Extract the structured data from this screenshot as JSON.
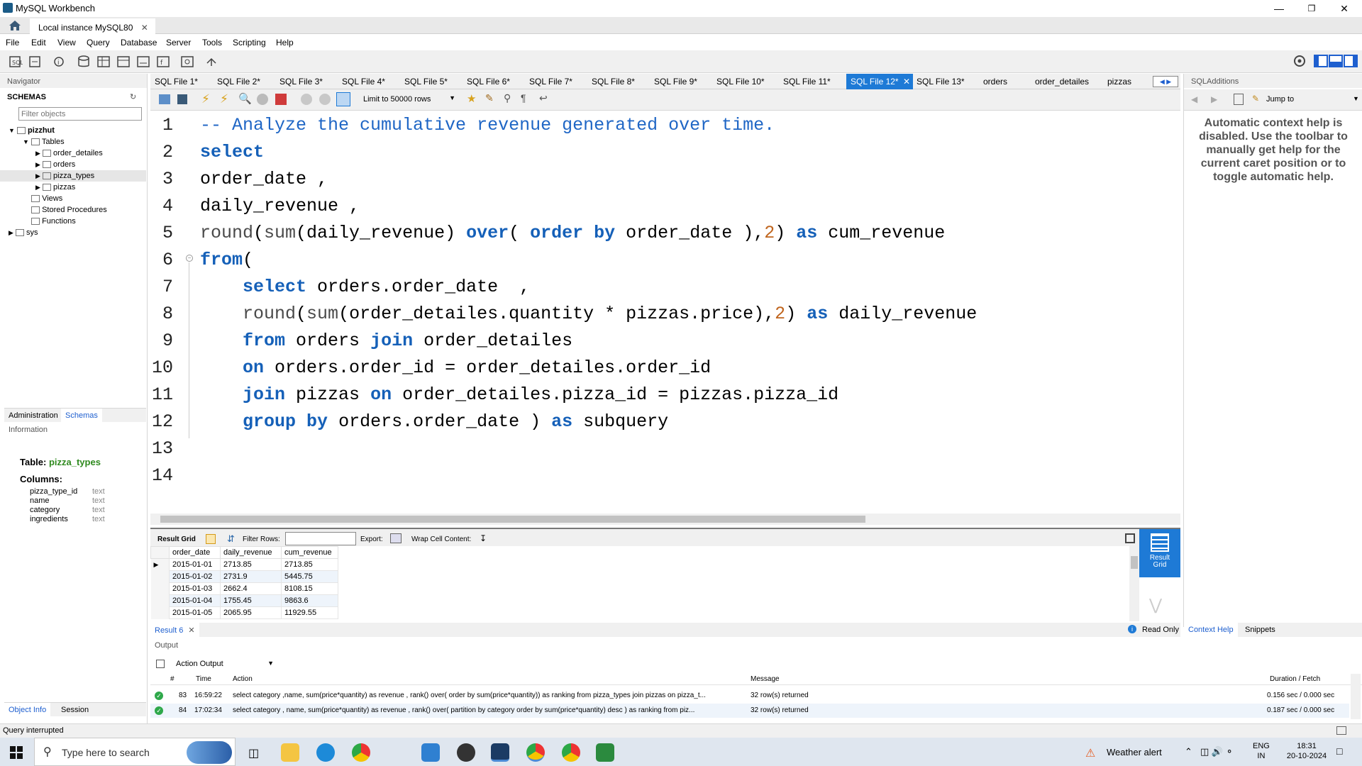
{
  "window": {
    "title": "MySQL Workbench",
    "connection_tab": "Local instance MySQL80"
  },
  "menu": [
    "File",
    "Edit",
    "View",
    "Query",
    "Database",
    "Server",
    "Tools",
    "Scripting",
    "Help"
  ],
  "navigator": {
    "header": "Navigator",
    "schemas_title": "SCHEMAS",
    "filter_placeholder": "Filter objects",
    "tree": {
      "db": "pizzhut",
      "tables_label": "Tables",
      "tables": [
        "order_detailes",
        "orders",
        "pizza_types",
        "pizzas"
      ],
      "views": "Views",
      "procs": "Stored Procedures",
      "funcs": "Functions",
      "sys": "sys"
    },
    "tabs": {
      "admin": "Administration",
      "schemas": "Schemas"
    },
    "info_header": "Information",
    "info": {
      "table_label": "Table:",
      "table_name": "pizza_types",
      "columns_label": "Columns:",
      "columns": [
        {
          "name": "pizza_type_id",
          "type": "text"
        },
        {
          "name": "name",
          "type": "text"
        },
        {
          "name": "category",
          "type": "text"
        },
        {
          "name": "ingredients",
          "type": "text"
        }
      ]
    },
    "bottom_tabs": {
      "object_info": "Object Info",
      "session": "Session"
    }
  },
  "editor_tabs": [
    "SQL File 1*",
    "SQL File 2*",
    "SQL File 3*",
    "SQL File 4*",
    "SQL File 5*",
    "SQL File 6*",
    "SQL File 7*",
    "SQL File 8*",
    "SQL File 9*",
    "SQL File 10*",
    "SQL File 11*",
    "SQL File 12*",
    "SQL File 13*",
    "orders",
    "order_detailes",
    "pizzas"
  ],
  "active_tab": "SQL File 12*",
  "editor_toolbar": {
    "limit": "Limit to 50000 rows"
  },
  "code": [
    "-- Analyze the cumulative revenue generated over time.",
    "select",
    "order_date ,",
    "daily_revenue ,",
    "round(sum(daily_revenue) over( order by order_date ),2) as cum_revenue",
    "from(",
    "    select orders.order_date  ,",
    "    round(sum(order_detailes.quantity * pizzas.price),2) as daily_revenue",
    "    from orders join order_detailes",
    "    on orders.order_id = order_detailes.order_id",
    "    join pizzas on order_detailes.pizza_id = pizzas.pizza_id",
    "    group by orders.order_date ) as subquery",
    "",
    ""
  ],
  "result_toolbar": {
    "result_grid": "Result Grid",
    "filter_rows": "Filter Rows:",
    "export": "Export:",
    "wrap": "Wrap Cell Content:"
  },
  "result": {
    "columns": [
      "order_date",
      "daily_revenue",
      "cum_revenue"
    ],
    "rows": [
      [
        "2015-01-01",
        "2713.85",
        "2713.85"
      ],
      [
        "2015-01-02",
        "2731.9",
        "5445.75"
      ],
      [
        "2015-01-03",
        "2662.4",
        "8108.15"
      ],
      [
        "2015-01-04",
        "1755.45",
        "9863.6"
      ],
      [
        "2015-01-05",
        "2065.95",
        "11929.55"
      ]
    ],
    "tab": "Result 6",
    "side_button": "Result Grid",
    "read_only": "Read Only"
  },
  "sql_additions": {
    "header": "SQLAdditions",
    "jump_to": "Jump to",
    "help_text": "Automatic context help is disabled. Use the toolbar to manually get help for the current caret position or to toggle automatic help.",
    "tabs": {
      "context_help": "Context Help",
      "snippets": "Snippets"
    }
  },
  "output": {
    "header": "Output",
    "selector": "Action Output",
    "columns": {
      "num": "#",
      "time": "Time",
      "action": "Action",
      "message": "Message",
      "duration": "Duration / Fetch"
    },
    "rows": [
      {
        "num": "83",
        "time": "16:59:22",
        "action": "select category ,name, sum(price*quantity) as revenue ,   rank() over( order by  sum(price*quantity)) as ranking  from pizza_types  join pizzas on pizza_t...",
        "message": "32 row(s) returned",
        "duration": "0.156 sec / 0.000 sec"
      },
      {
        "num": "84",
        "time": "17:02:34",
        "action": "select   category ,  name,   sum(price*quantity) as revenue ,   rank() over( partition by category order by  sum(price*quantity) desc )  as ranking   from   piz...",
        "message": "32 row(s) returned",
        "duration": "0.187 sec / 0.000 sec"
      }
    ]
  },
  "status": "Query interrupted",
  "taskbar": {
    "search": "Type here to search",
    "weather": "Weather alert",
    "lang1": "ENG",
    "lang2": "IN",
    "time": "18:31",
    "date": "20-10-2024"
  },
  "colors": {
    "accent": "#1e7ad6",
    "keyword": "#1560b8",
    "number": "#c0651e"
  }
}
